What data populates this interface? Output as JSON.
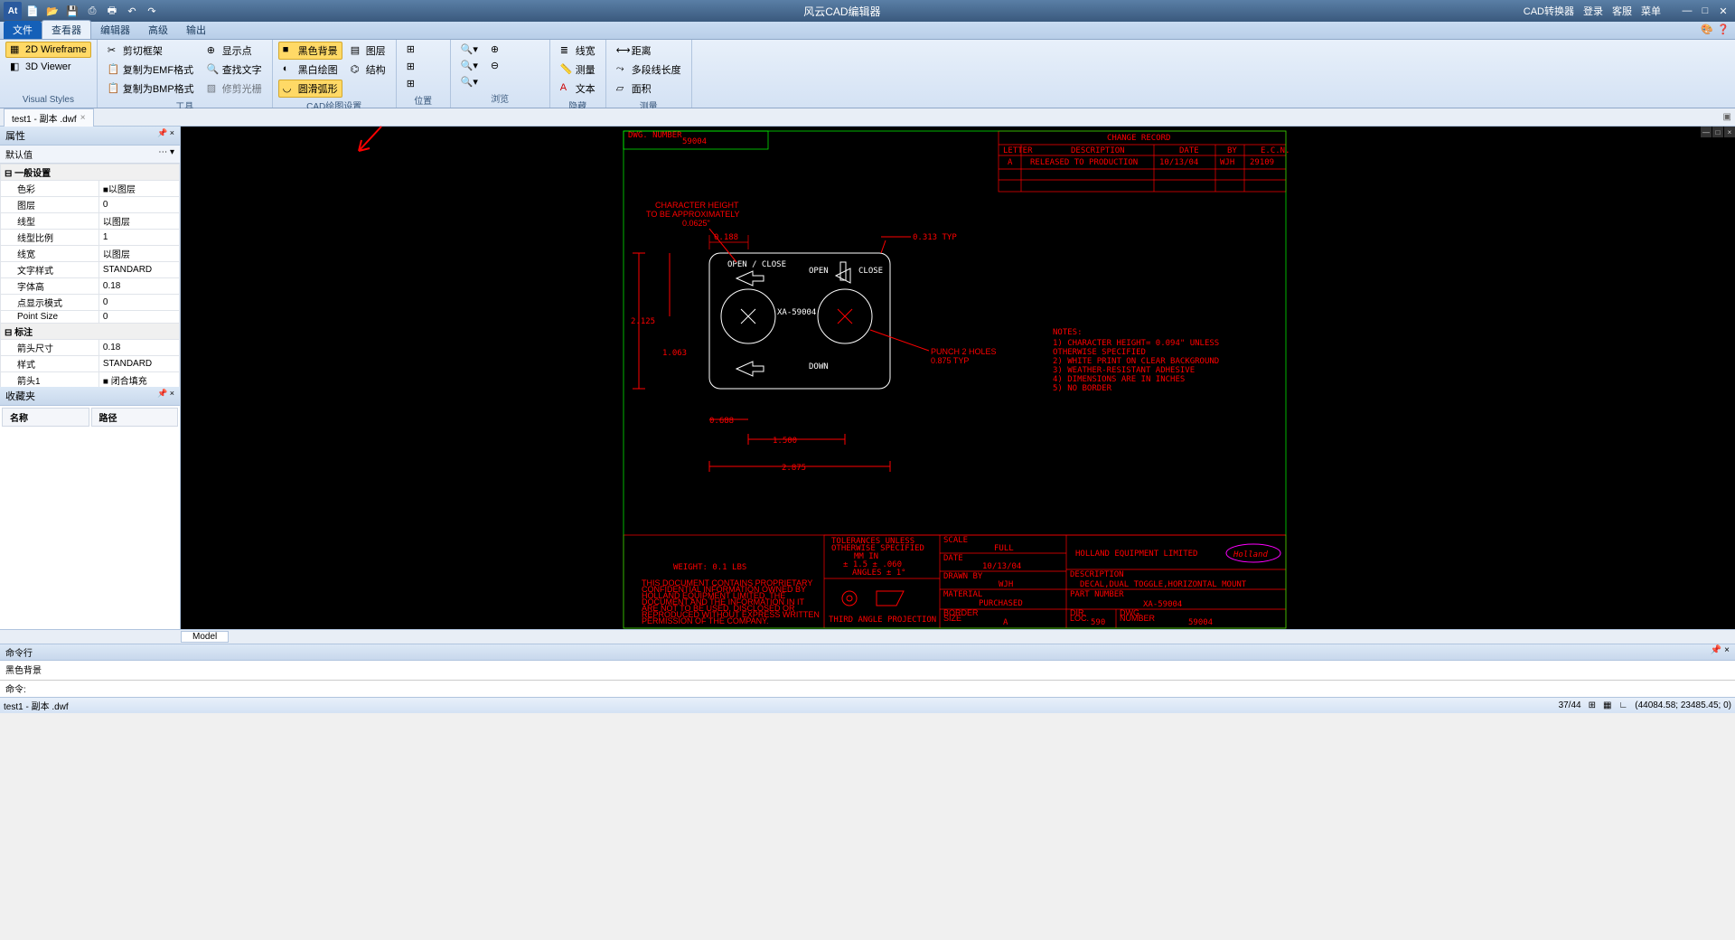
{
  "app": {
    "title": "风云CAD编辑器"
  },
  "titlebar_right": [
    "CAD转换器",
    "登录",
    "客服",
    "菜单"
  ],
  "ribbon_tabs": {
    "file": "文件",
    "items": [
      "查看器",
      "编辑器",
      "高级",
      "输出"
    ],
    "active": 0
  },
  "ribbon_groups": {
    "visual": {
      "title": "Visual Styles",
      "wireframe": "2D Wireframe",
      "viewer": "3D Viewer"
    },
    "tools": {
      "title": "工具",
      "cut": "剪切框架",
      "emf": "复制为EMF格式",
      "bmp": "复制为BMP格式",
      "showpoint": "显示点",
      "findtext": "查找文字",
      "trim": "修剪光栅"
    },
    "cadset": {
      "title": "CAD绘图设置",
      "blackbg": "黑色背景",
      "bw": "黑白绘图",
      "smooth": "圆滑弧形",
      "layer": "图层",
      "struct": "结构"
    },
    "pos": {
      "title": "位置"
    },
    "browse": {
      "title": "浏览"
    },
    "hide": {
      "title": "隐藏",
      "linew": "线宽",
      "meas": "测量",
      "text": "文本"
    },
    "measure": {
      "title": "测量",
      "dist": "距离",
      "poly": "多段线长度",
      "area": "面积"
    }
  },
  "doc_tab": "test1 - 副本 .dwf",
  "props": {
    "title": "属性",
    "sub": "默认值",
    "sections": {
      "general": "一般设置",
      "annotation": "标注"
    },
    "rows": [
      {
        "k": "色彩",
        "v": "■以图层"
      },
      {
        "k": "图层",
        "v": "0"
      },
      {
        "k": "线型",
        "v": "以图层"
      },
      {
        "k": "线型比例",
        "v": "1"
      },
      {
        "k": "线宽",
        "v": "以图层"
      },
      {
        "k": "文字样式",
        "v": "STANDARD"
      },
      {
        "k": "字体高",
        "v": "0.18"
      },
      {
        "k": "点显示模式",
        "v": "0"
      },
      {
        "k": "Point Size",
        "v": "0"
      }
    ],
    "annot_rows": [
      {
        "k": "箭头尺寸",
        "v": "0.18"
      },
      {
        "k": "样式",
        "v": "STANDARD"
      },
      {
        "k": "箭头1",
        "v": "■ 闭合填充"
      },
      {
        "k": "箭头2",
        "v": "■ 闭合填充"
      }
    ]
  },
  "favorites": {
    "title": "收藏夹",
    "col1": "名称",
    "col2": "路径"
  },
  "model_tab": "Model",
  "cmd": {
    "title": "命令行",
    "output": "黑色背景",
    "prompt": "命令:"
  },
  "status": {
    "file": "test1 - 副本 .dwf",
    "page": "37/44",
    "coords": "(44084.58; 23485.45; 0)"
  },
  "drawing": {
    "dwg_number_label": "DWG.\nNUMBER",
    "dwg_number": "59004",
    "change_record": "CHANGE RECORD",
    "cr_headers": [
      "LETTER",
      "DESCRIPTION",
      "DATE",
      "BY",
      "E.C.N."
    ],
    "cr_row": [
      "A",
      "RELEASED TO PRODUCTION",
      "10/13/04",
      "WJH",
      "29109"
    ],
    "char_height": "CHARACTER HEIGHT\nTO BE APPROXIMATELY\n0.0625\"",
    "d_0188": "0.188",
    "d_0313": "0.313 TYP",
    "open_close": "OPEN / CLOSE",
    "open": "OPEN",
    "close": "CLOSE",
    "d_2125": "2.125",
    "d_1063": "1.063",
    "d_0688": "0.688",
    "d_1500": "1.500",
    "d_2875": "2.875",
    "down": "DOWN",
    "xa": "XA-59004",
    "punch": "PUNCH 2 HOLES\n0.875 TYP",
    "notes_h": "NOTES:",
    "notes": [
      "1)  CHARACTER HEIGHT= 0.094\" UNLESS",
      "    OTHERWISE  SPECIFIED",
      "2)  WHITE PRINT ON CLEAR BACKGROUND",
      "3)  WEATHER-RESISTANT ADHESIVE",
      "4)  DIMENSIONS ARE IN INCHES",
      "5)  NO BORDER"
    ],
    "weight": "WEIGHT:  0.1  LBS",
    "tol1": "TOLERANCES  UNLESS",
    "tol2": "OTHERWISE  SPECIFIED",
    "tol3": "MM       IN",
    "tol4": "± 1.5    ± .060",
    "tol5": "ANGLES  ± 1°",
    "third_angle": "THIRD  ANGLE  PROJECTION",
    "legal": "THIS  DOCUMENT  CONTAINS  PROPRIETARY\nCONFIDENTIAL INFORMATION  OWNED  BY\nHOLLAND  EQUIPMENT  LIMITED.  THE\nDOCUMENT  AND  THE  INFORMATION  IN  IT\nARE  NOT  TO  BE  USED,  DISCLOSED  OR\nREPRODUCED  WITHOUT  EXPRESS  WRITTEN\nPERMISSION  OF  THE  COMPANY.",
    "tb": {
      "scale_l": "SCALE",
      "scale": "FULL",
      "date_l": "DATE",
      "date": "10/13/04",
      "drawn_l": "DRAWN BY",
      "drawn": "WJH",
      "mat_l": "MATERIAL",
      "mat": "PURCHASED",
      "bs_l": "BORDER\nSIZE",
      "bs": "A",
      "company": "HOLLAND  EQUIPMENT  LIMITED",
      "brand": "Holland",
      "desc_l": "DESCRIPTION",
      "desc": "DECAL,DUAL TOGGLE,HORIZONTAL  MOUNT",
      "pn_l": "PART NUMBER",
      "pn": "XA-59004",
      "dir_l": "DIR.\nLOC.",
      "dir": "590",
      "dn_l": "DWG.\nNUMBER",
      "dn": "59004"
    }
  }
}
